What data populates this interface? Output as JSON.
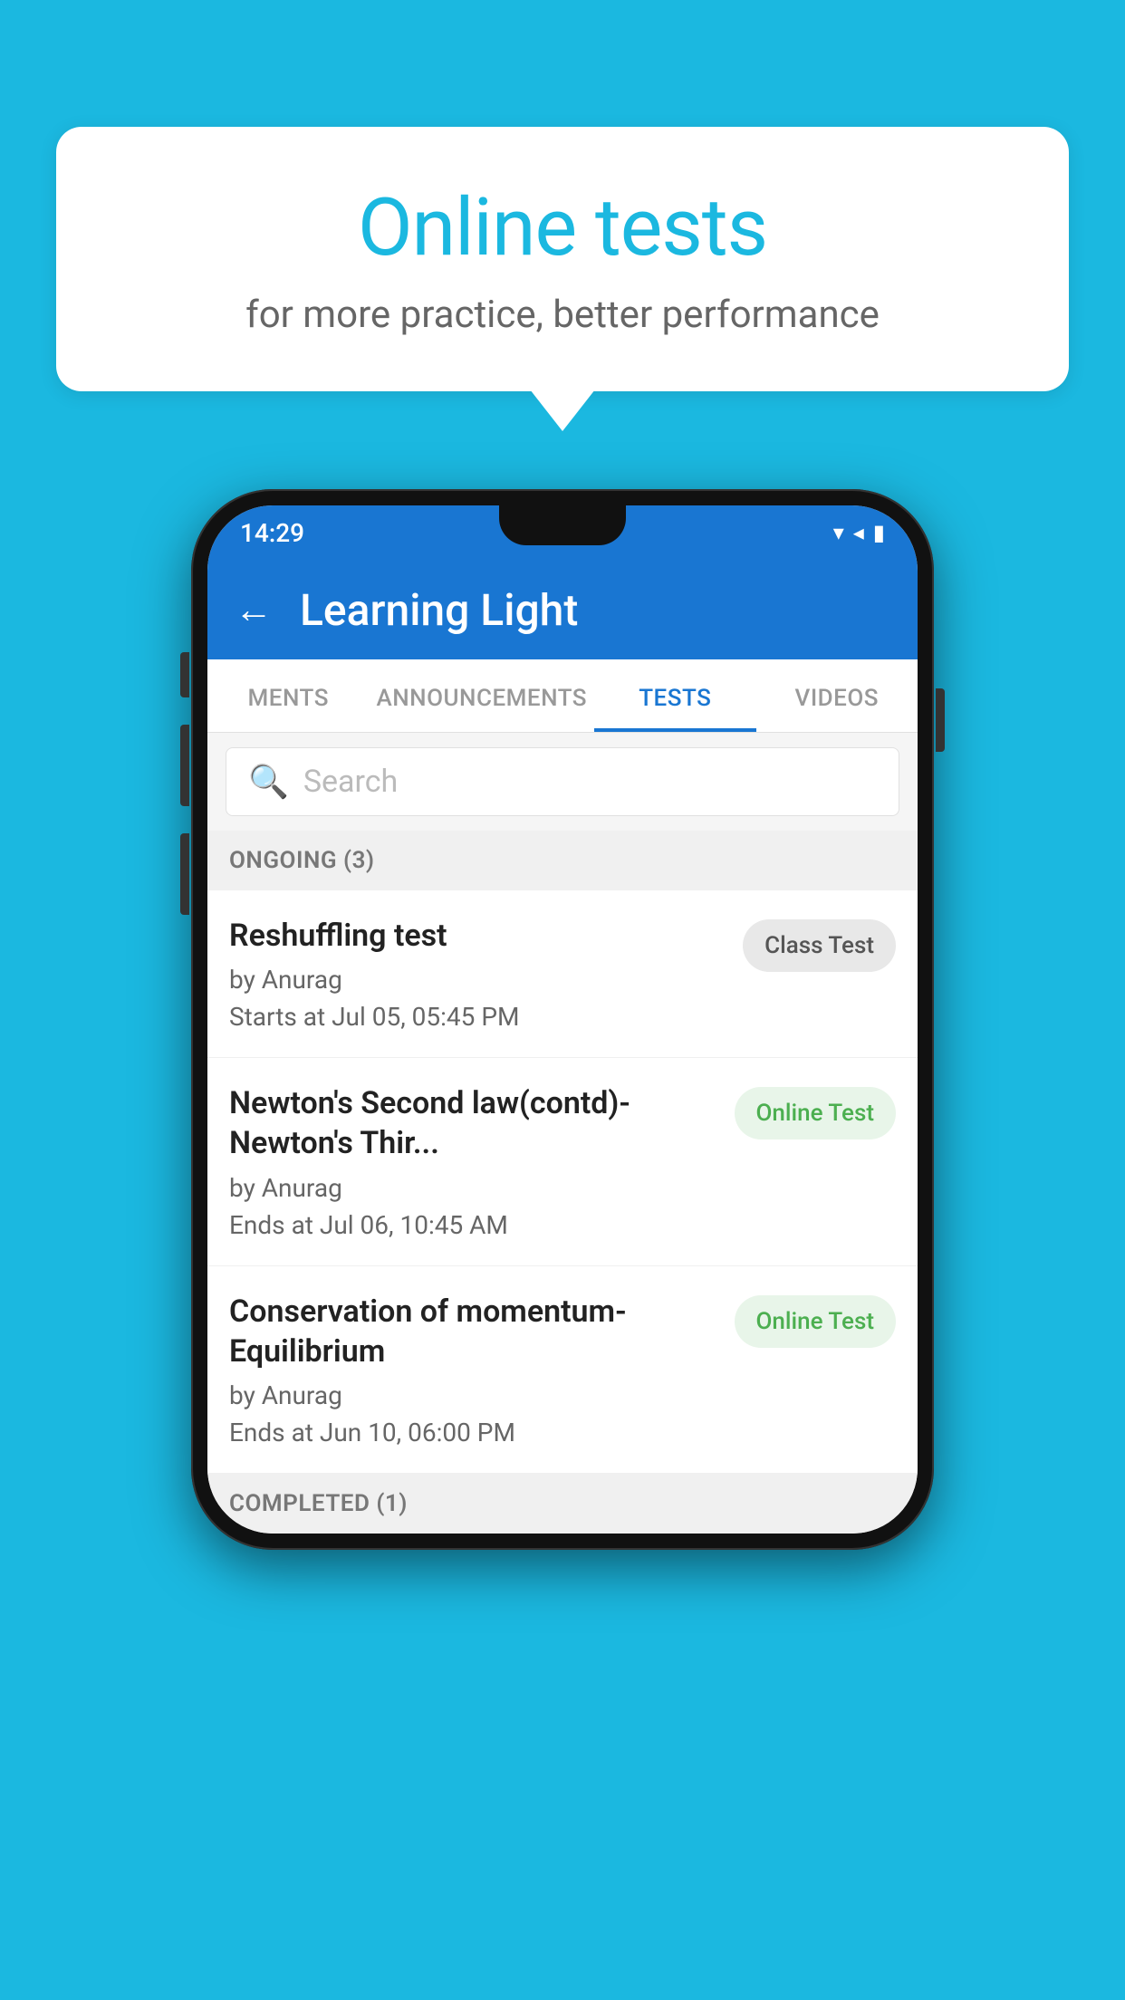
{
  "background_color": "#1BB8E0",
  "speech_bubble": {
    "title": "Online tests",
    "subtitle": "for more practice, better performance"
  },
  "phone": {
    "status_bar": {
      "time": "14:29",
      "icons": "▾◂▮"
    },
    "app_bar": {
      "title": "Learning Light",
      "back_label": "←"
    },
    "tabs": [
      {
        "label": "MENTS",
        "active": false
      },
      {
        "label": "ANNOUNCEMENTS",
        "active": false
      },
      {
        "label": "TESTS",
        "active": true
      },
      {
        "label": "VIDEOS",
        "active": false
      }
    ],
    "search": {
      "placeholder": "Search",
      "icon": "🔍"
    },
    "ongoing_section": {
      "label": "ONGOING (3)",
      "items": [
        {
          "title": "Reshuffling test",
          "author": "by Anurag",
          "date": "Starts at  Jul 05, 05:45 PM",
          "badge": "Class Test",
          "badge_type": "class"
        },
        {
          "title": "Newton's Second law(contd)-Newton's Thir...",
          "author": "by Anurag",
          "date": "Ends at  Jul 06, 10:45 AM",
          "badge": "Online Test",
          "badge_type": "online"
        },
        {
          "title": "Conservation of momentum-Equilibrium",
          "author": "by Anurag",
          "date": "Ends at  Jun 10, 06:00 PM",
          "badge": "Online Test",
          "badge_type": "online"
        }
      ]
    },
    "completed_section": {
      "label": "COMPLETED (1)"
    }
  }
}
